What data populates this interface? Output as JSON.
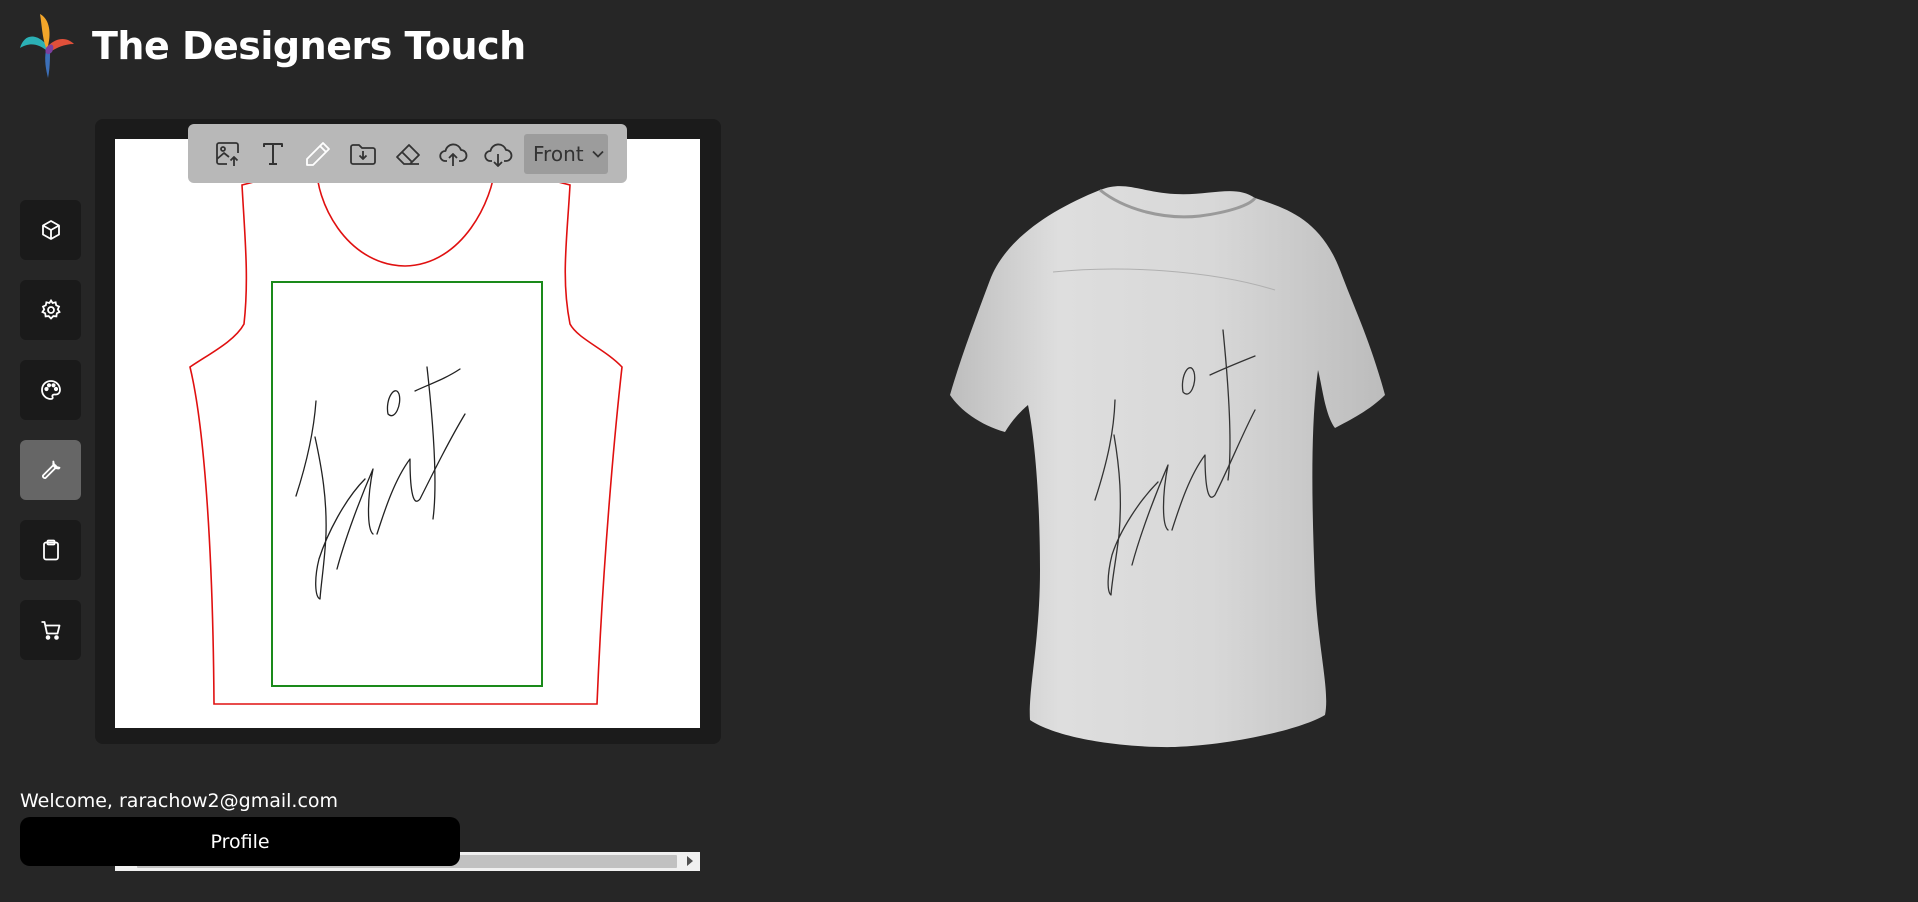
{
  "theme": {
    "background": "#262626",
    "outline_color": "#e01010",
    "print_area_color": "#1a8a1a"
  },
  "app": {
    "title": "The Designers Touch",
    "logo_icon": "hummingbird-logo"
  },
  "sidebar": {
    "items": [
      {
        "icon": "box-icon",
        "active": false
      },
      {
        "icon": "gear-icon",
        "active": false
      },
      {
        "icon": "palette-icon",
        "active": false
      },
      {
        "icon": "wrench-icon",
        "active": true
      },
      {
        "icon": "clipboard-icon",
        "active": false
      },
      {
        "icon": "cart-icon",
        "active": false
      }
    ]
  },
  "toolbar": {
    "tools": [
      "image-upload-icon",
      "text-icon",
      "pencil-icon",
      "folder-download-icon",
      "eraser-icon",
      "cloud-upload-icon",
      "cloud-download-icon"
    ],
    "view_select": {
      "value": "Front"
    }
  },
  "user": {
    "welcome": "Welcome, rarachow2@gmail.com",
    "profile_label": "Profile"
  }
}
